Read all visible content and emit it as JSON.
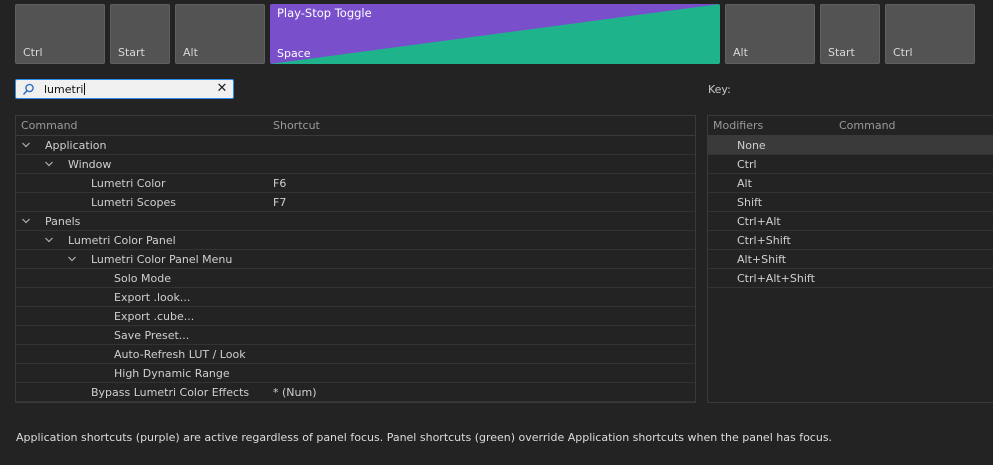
{
  "keyboard": {
    "left_keys": [
      {
        "label": "Ctrl"
      },
      {
        "label": "Start"
      },
      {
        "label": "Alt"
      }
    ],
    "space_key": {
      "label": "Space",
      "command": "Play-Stop Toggle",
      "colors": [
        "#7a4fcc",
        "#1eb38a"
      ]
    },
    "right_keys": [
      {
        "label": "Alt"
      },
      {
        "label": "Start"
      },
      {
        "label": "Ctrl"
      }
    ]
  },
  "search": {
    "value": "lumetri",
    "icon": "search-icon",
    "clear_icon": "close-icon"
  },
  "key_panel": {
    "title": "Key:"
  },
  "commands": {
    "headers": {
      "command": "Command",
      "shortcut": "Shortcut"
    },
    "rows": [
      {
        "label": "Application",
        "shortcut": "",
        "level": 0,
        "expandable": true
      },
      {
        "label": "Window",
        "shortcut": "",
        "level": 1,
        "expandable": true
      },
      {
        "label": "Lumetri Color",
        "shortcut": "F6",
        "level": 2,
        "expandable": false
      },
      {
        "label": "Lumetri Scopes",
        "shortcut": "F7",
        "level": 2,
        "expandable": false
      },
      {
        "label": "Panels",
        "shortcut": "",
        "level": 0,
        "expandable": true
      },
      {
        "label": "Lumetri Color Panel",
        "shortcut": "",
        "level": 1,
        "expandable": true
      },
      {
        "label": "Lumetri Color Panel Menu",
        "shortcut": "",
        "level": 2,
        "expandable": true
      },
      {
        "label": "Solo Mode",
        "shortcut": "",
        "level": 3,
        "expandable": false
      },
      {
        "label": "Export .look...",
        "shortcut": "",
        "level": 3,
        "expandable": false
      },
      {
        "label": "Export .cube...",
        "shortcut": "",
        "level": 3,
        "expandable": false
      },
      {
        "label": "Save Preset...",
        "shortcut": "",
        "level": 3,
        "expandable": false
      },
      {
        "label": "Auto-Refresh LUT / Look",
        "shortcut": "",
        "level": 3,
        "expandable": false
      },
      {
        "label": "High Dynamic Range",
        "shortcut": "",
        "level": 3,
        "expandable": false
      },
      {
        "label": "Bypass Lumetri Color Effects",
        "shortcut": "* (Num)",
        "level": 2,
        "expandable": false
      }
    ]
  },
  "modifiers": {
    "headers": {
      "modifiers": "Modifiers",
      "command": "Command"
    },
    "rows": [
      {
        "label": "None",
        "selected": true
      },
      {
        "label": "Ctrl",
        "selected": false
      },
      {
        "label": "Alt",
        "selected": false
      },
      {
        "label": "Shift",
        "selected": false
      },
      {
        "label": "Ctrl+Alt",
        "selected": false
      },
      {
        "label": "Ctrl+Shift",
        "selected": false
      },
      {
        "label": "Alt+Shift",
        "selected": false
      },
      {
        "label": "Ctrl+Alt+Shift",
        "selected": false
      }
    ]
  },
  "footer": {
    "text": "Application shortcuts (purple) are active regardless of panel focus. Panel shortcuts (green) override Application shortcuts when the panel has focus."
  },
  "colors": {
    "application": "#7a4fcc",
    "panel": "#1eb38a",
    "search_focus": "#2d8ceb"
  }
}
